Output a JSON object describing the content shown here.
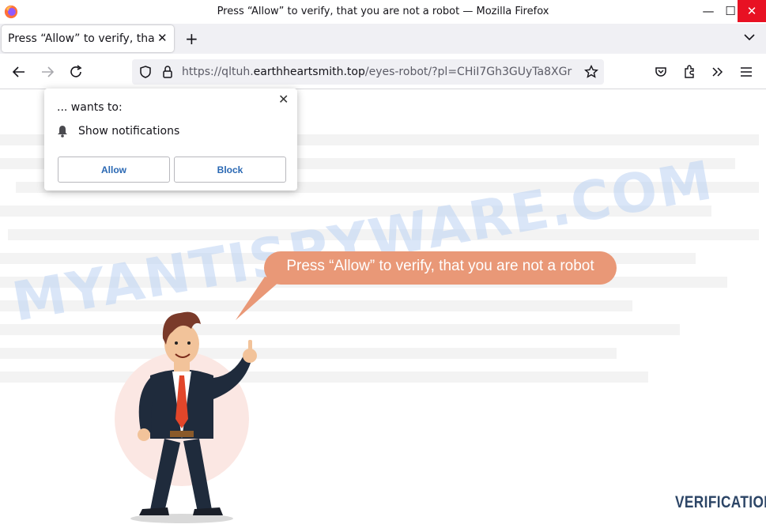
{
  "window": {
    "title": "Press “Allow” to verify, that you are not a robot — Mozilla Firefox",
    "minimize": "—",
    "maximize": "☐",
    "close": "✕"
  },
  "tabs": [
    {
      "title": "Press “Allow” to verify, that you are not a robot",
      "close": "✕"
    }
  ],
  "newtab_symbol": "+",
  "urlbar": {
    "prefix": "https://qltuh.",
    "host": "earthheartsmith.top",
    "path": "/eyes-robot/?pl=CHiI7Gh3GUyTa8XGr"
  },
  "popup": {
    "wants": "... wants to:",
    "permission": "Show notifications",
    "allow": "Allow",
    "block": "Block",
    "close": "✕"
  },
  "page": {
    "bubble": "Press “Allow” to verify, that you are not a robot",
    "badge": "VERIFICATION",
    "watermark": "MYANTISPYWARE.COM"
  },
  "colors": {
    "bubble": "#e99877",
    "link_blue": "#2a68b3",
    "close_red": "#e81123",
    "badge": "#2c4566"
  },
  "icons": [
    "firefox-logo-icon",
    "back-arrow-icon",
    "forward-arrow-icon",
    "reload-icon",
    "shield-icon",
    "lock-icon",
    "star-icon",
    "pocket-icon",
    "extensions-icon",
    "overflow-chevrons-icon",
    "hamburger-menu-icon",
    "bell-icon",
    "chevron-down-icon"
  ]
}
